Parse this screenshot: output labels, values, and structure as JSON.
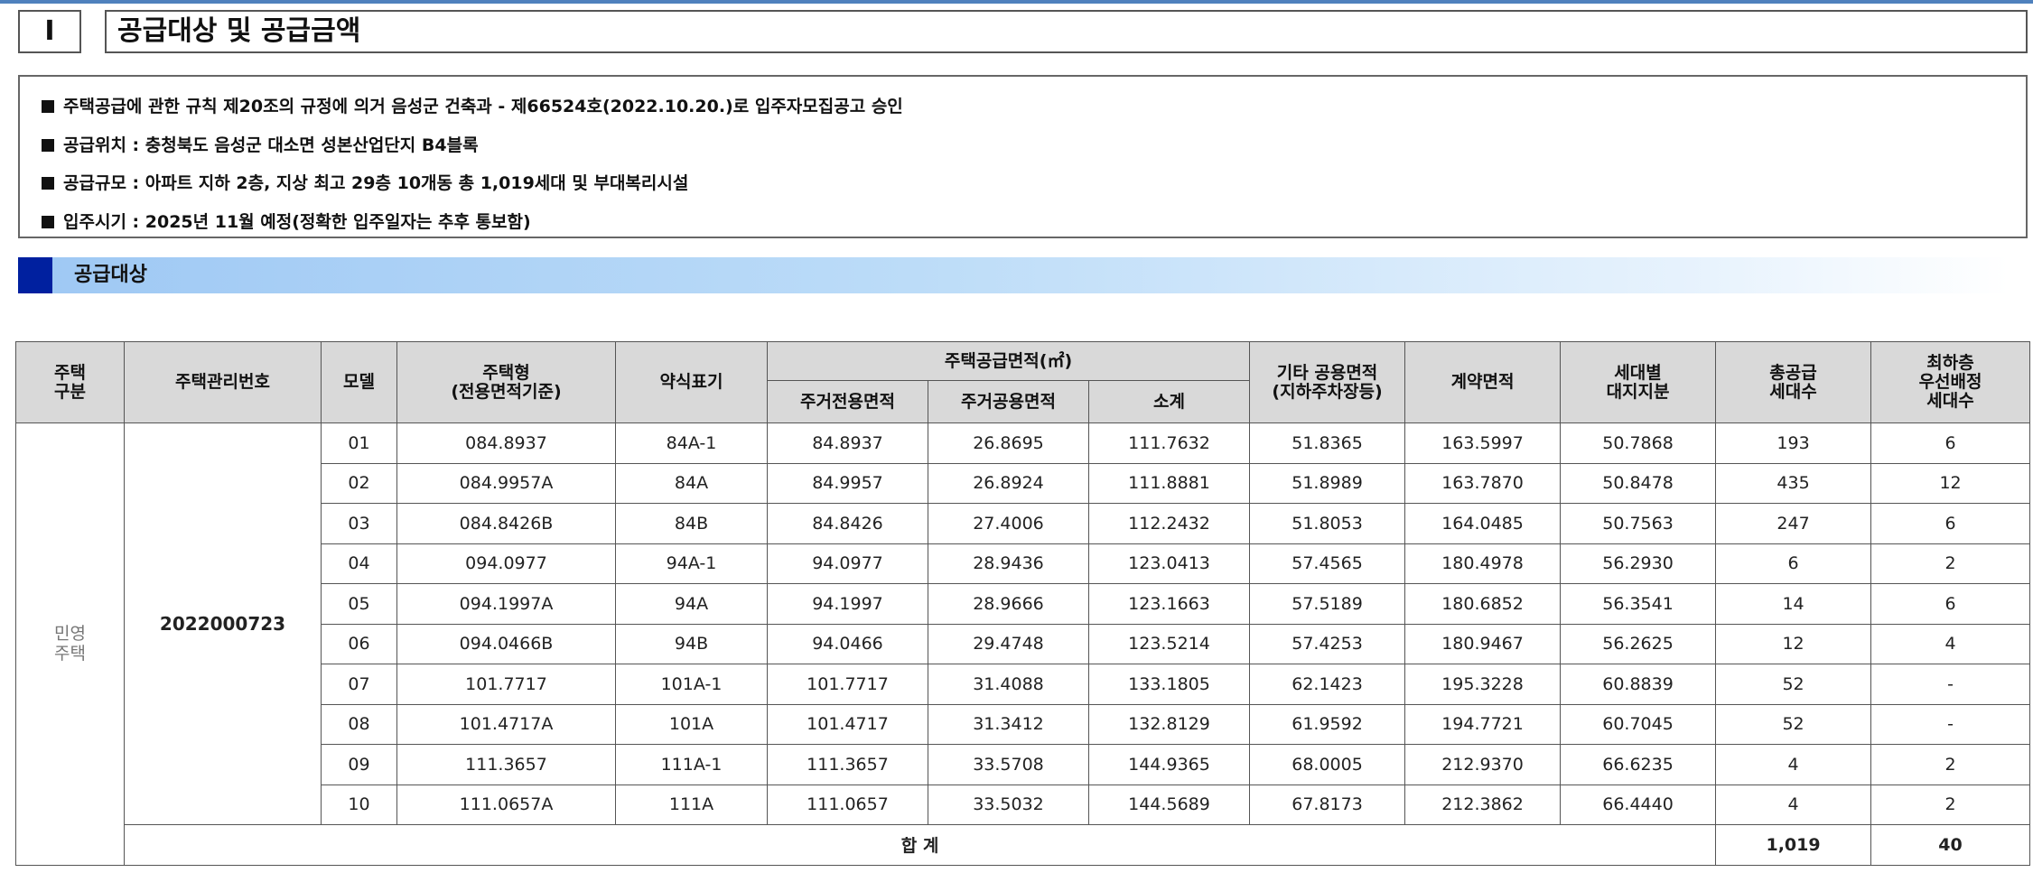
{
  "section": {
    "number": "Ⅰ",
    "title": "공급대상 및 공급금액"
  },
  "notes": [
    "주택공급에 관한 규칙 제20조의 규정에 의거 음성군 건축과 - 제66524호(2022.10.20.)로 입주자모집공고 승인",
    "공급위치 : 충청북도 음성군 대소면 성본산업단지 B4블록",
    "공급규모 : 아파트 지하 2층, 지상 최고 29층 10개동 총 1,019세대 및 부대복리시설",
    "입주시기 : 2025년 11월 예정(정확한 입주일자는 추후 통보함)"
  ],
  "subsection": {
    "label": "공급대상"
  },
  "colors": {
    "band_mark": "#00209f",
    "band_light": "#9ec8f4",
    "header_bg": "#d9d9d9",
    "top_rule": "#4f81bd"
  },
  "table": {
    "headers": {
      "kind": [
        "주택",
        "구분"
      ],
      "mgmt": "주택관리번호",
      "model": "모델",
      "type": [
        "주택형",
        "(전용면적기준)"
      ],
      "short": "약식표기",
      "area_group": "주택공급면적(㎡)",
      "exclusive": "주거전용면적",
      "common": "주거공용면적",
      "subtotal": "소계",
      "other": [
        "기타 공용면적",
        "(지하주차장등)"
      ],
      "contract": "계약면적",
      "land": [
        "세대별",
        "대지지분"
      ],
      "total_units": [
        "총공급",
        "세대수"
      ],
      "low_floor": [
        "최하층",
        "우선배정",
        "세대수"
      ]
    },
    "kind_value": [
      "민영",
      "주택"
    ],
    "mgmt_no": "2022000723",
    "rows": [
      {
        "model": "01",
        "type": "084.8937",
        "short": "84A-1",
        "exclusive": "84.8937",
        "common": "26.8695",
        "subtotal": "111.7632",
        "other": "51.8365",
        "contract": "163.5997",
        "land": "50.7868",
        "units": "193",
        "low": "6"
      },
      {
        "model": "02",
        "type": "084.9957A",
        "short": "84A",
        "exclusive": "84.9957",
        "common": "26.8924",
        "subtotal": "111.8881",
        "other": "51.8989",
        "contract": "163.7870",
        "land": "50.8478",
        "units": "435",
        "low": "12"
      },
      {
        "model": "03",
        "type": "084.8426B",
        "short": "84B",
        "exclusive": "84.8426",
        "common": "27.4006",
        "subtotal": "112.2432",
        "other": "51.8053",
        "contract": "164.0485",
        "land": "50.7563",
        "units": "247",
        "low": "6"
      },
      {
        "model": "04",
        "type": "094.0977",
        "short": "94A-1",
        "exclusive": "94.0977",
        "common": "28.9436",
        "subtotal": "123.0413",
        "other": "57.4565",
        "contract": "180.4978",
        "land": "56.2930",
        "units": "6",
        "low": "2"
      },
      {
        "model": "05",
        "type": "094.1997A",
        "short": "94A",
        "exclusive": "94.1997",
        "common": "28.9666",
        "subtotal": "123.1663",
        "other": "57.5189",
        "contract": "180.6852",
        "land": "56.3541",
        "units": "14",
        "low": "6"
      },
      {
        "model": "06",
        "type": "094.0466B",
        "short": "94B",
        "exclusive": "94.0466",
        "common": "29.4748",
        "subtotal": "123.5214",
        "other": "57.4253",
        "contract": "180.9467",
        "land": "56.2625",
        "units": "12",
        "low": "4"
      },
      {
        "model": "07",
        "type": "101.7717",
        "short": "101A-1",
        "exclusive": "101.7717",
        "common": "31.4088",
        "subtotal": "133.1805",
        "other": "62.1423",
        "contract": "195.3228",
        "land": "60.8839",
        "units": "52",
        "low": "-"
      },
      {
        "model": "08",
        "type": "101.4717A",
        "short": "101A",
        "exclusive": "101.4717",
        "common": "31.3412",
        "subtotal": "132.8129",
        "other": "61.9592",
        "contract": "194.7721",
        "land": "60.7045",
        "units": "52",
        "low": "-"
      },
      {
        "model": "09",
        "type": "111.3657",
        "short": "111A-1",
        "exclusive": "111.3657",
        "common": "33.5708",
        "subtotal": "144.9365",
        "other": "68.0005",
        "contract": "212.9370",
        "land": "66.6235",
        "units": "4",
        "low": "2"
      },
      {
        "model": "10",
        "type": "111.0657A",
        "short": "111A",
        "exclusive": "111.0657",
        "common": "33.5032",
        "subtotal": "144.5689",
        "other": "67.8173",
        "contract": "212.3862",
        "land": "66.4440",
        "units": "4",
        "low": "2"
      }
    ],
    "total": {
      "label": "합 계",
      "units": "1,019",
      "low": "40"
    }
  }
}
